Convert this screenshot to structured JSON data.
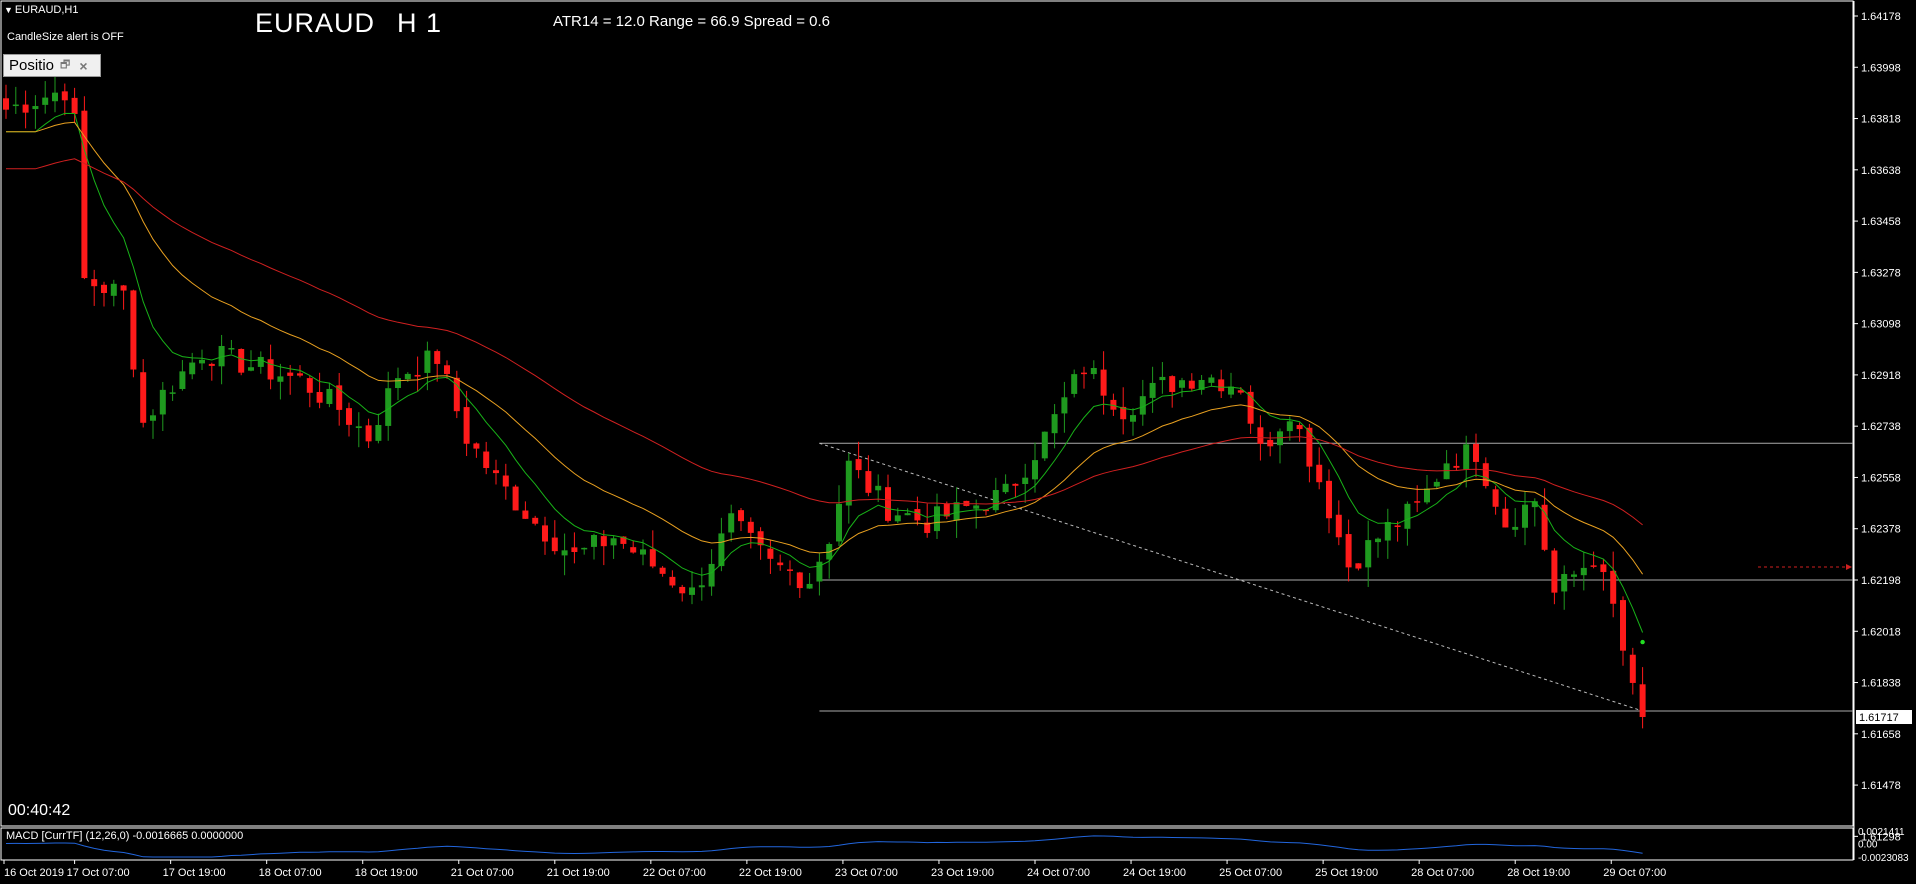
{
  "header": {
    "symbol_tf": "EURAUD,H1",
    "alert_text": "CandleSize alert is OFF",
    "big_symbol": "EURAUD",
    "big_tf": "H 1",
    "atr_text": "ATR14 = 12.0 Range = 66.9 Spread = 0.6"
  },
  "position_panel": {
    "label": "Positio"
  },
  "timer": "00:40:42",
  "macd": {
    "label": "MACD [CurrTF] (12,26,0) -0.0016665 0.0000000",
    "axis_labels": [
      "0.0021411",
      "0.00",
      "-0.0023083"
    ]
  },
  "colors": {
    "bull": "#1f9a1f",
    "bear": "#ff1a1a",
    "ma_fast": "#18b218",
    "ma_mid": "#e8a020",
    "ma_slow": "#d02020",
    "macd": "#2266dd",
    "grid_line": "#aaaaaa",
    "axis": "#ffffff"
  },
  "chart_data": {
    "type": "candlestick",
    "symbol": "EURAUD",
    "timeframe": "H1",
    "y_ticks": [
      "1.64178",
      "1.63998",
      "1.63818",
      "1.63638",
      "1.63458",
      "1.63278",
      "1.63098",
      "1.62918",
      "1.62738",
      "1.62558",
      "1.62378",
      "1.62198",
      "1.62018",
      "1.61838",
      "1.61658",
      "1.61478",
      "1.61298"
    ],
    "ylim": [
      1.6125,
      1.6422
    ],
    "current_price": "1.61717",
    "x_ticks": [
      "16 Oct 2019",
      "17 Oct 07:00",
      "17 Oct 19:00",
      "18 Oct 07:00",
      "18 Oct 19:00",
      "21 Oct 07:00",
      "21 Oct 19:00",
      "22 Oct 07:00",
      "22 Oct 19:00",
      "23 Oct 07:00",
      "23 Oct 19:00",
      "24 Oct 07:00",
      "24 Oct 19:00",
      "25 Oct 07:00",
      "25 Oct 19:00",
      "28 Oct 07:00",
      "28 Oct 19:00",
      "29 Oct 07:00"
    ],
    "horizontal_levels": [
      1.62678,
      1.62198,
      1.61738
    ],
    "trendline": {
      "from": [
        83,
        1.62678
      ],
      "to": [
        167,
        1.61738
      ]
    },
    "anchors": [
      [
        0,
        1.6385
      ],
      [
        6,
        1.6392
      ],
      [
        7,
        1.638
      ],
      [
        8,
        1.6325
      ],
      [
        12,
        1.632
      ],
      [
        14,
        1.6275
      ],
      [
        16,
        1.6285
      ],
      [
        20,
        1.63
      ],
      [
        25,
        1.6295
      ],
      [
        30,
        1.629
      ],
      [
        34,
        1.628
      ],
      [
        37,
        1.627
      ],
      [
        40,
        1.6292
      ],
      [
        44,
        1.6298
      ],
      [
        47,
        1.627
      ],
      [
        50,
        1.6255
      ],
      [
        54,
        1.624
      ],
      [
        58,
        1.6228
      ],
      [
        62,
        1.6235
      ],
      [
        66,
        1.6225
      ],
      [
        70,
        1.6215
      ],
      [
        74,
        1.624
      ],
      [
        78,
        1.6225
      ],
      [
        82,
        1.622
      ],
      [
        84,
        1.6235
      ],
      [
        86,
        1.626
      ],
      [
        90,
        1.6245
      ],
      [
        94,
        1.624
      ],
      [
        98,
        1.6245
      ],
      [
        102,
        1.625
      ],
      [
        106,
        1.627
      ],
      [
        110,
        1.6295
      ],
      [
        114,
        1.628
      ],
      [
        118,
        1.6288
      ],
      [
        122,
        1.6292
      ],
      [
        126,
        1.6288
      ],
      [
        128,
        1.6265
      ],
      [
        131,
        1.628
      ],
      [
        134,
        1.6255
      ],
      [
        137,
        1.6225
      ],
      [
        141,
        1.6238
      ],
      [
        144,
        1.6245
      ],
      [
        147,
        1.6262
      ],
      [
        150,
        1.6265
      ],
      [
        153,
        1.624
      ],
      [
        156,
        1.6248
      ],
      [
        158,
        1.6215
      ],
      [
        162,
        1.6228
      ],
      [
        164,
        1.621
      ],
      [
        166,
        1.618
      ],
      [
        167,
        1.61717
      ]
    ]
  }
}
